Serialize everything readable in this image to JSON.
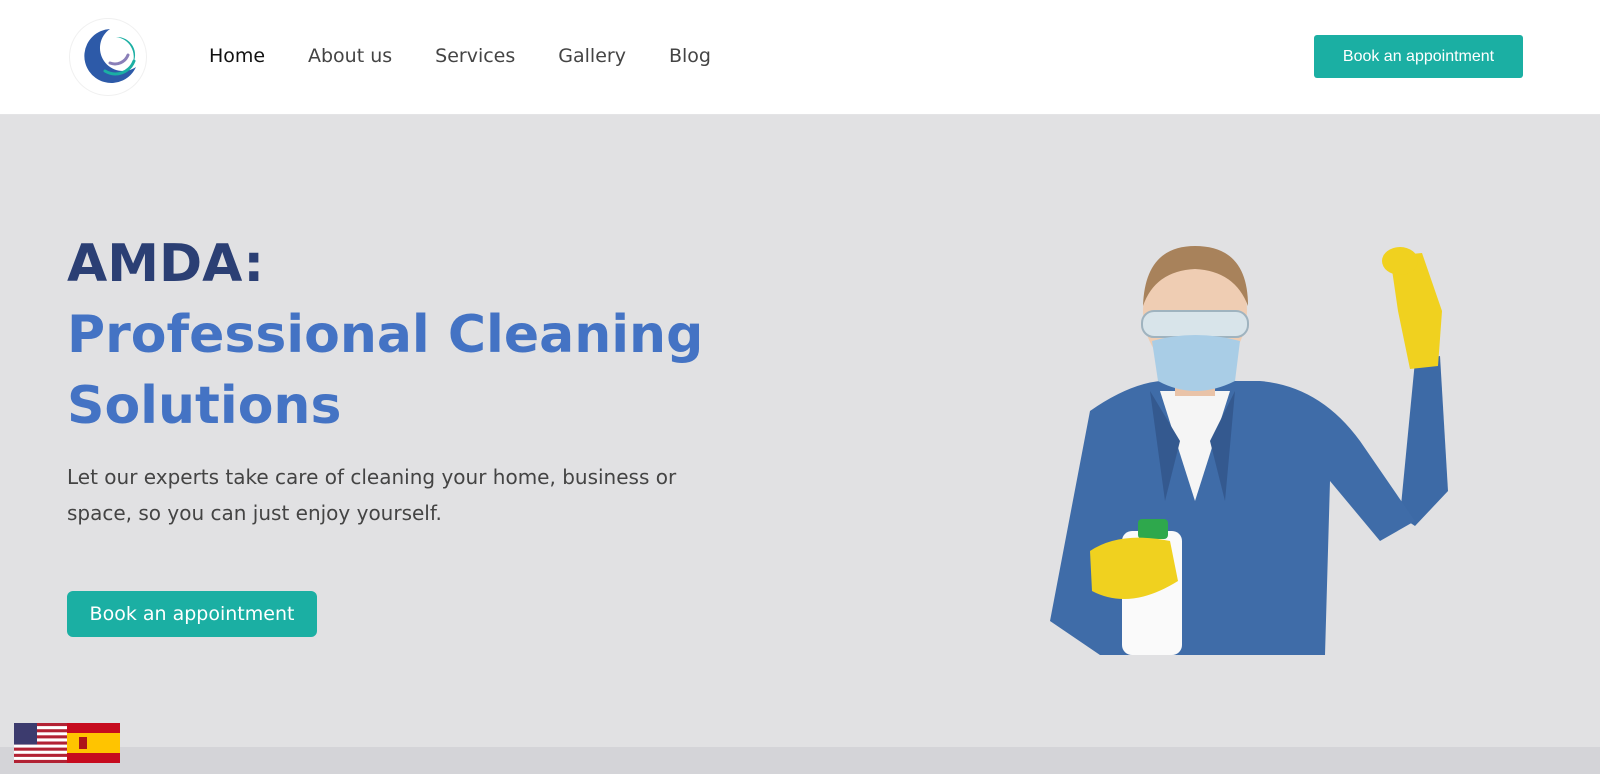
{
  "header": {
    "logo_icon": "crescent-swirl-logo-icon",
    "nav": [
      {
        "label": "Home",
        "active": true
      },
      {
        "label": "About us",
        "active": false
      },
      {
        "label": "Services",
        "active": false
      },
      {
        "label": "Gallery",
        "active": false
      },
      {
        "label": "Blog",
        "active": false
      }
    ],
    "cta_label": "Book an appointment"
  },
  "hero": {
    "brand": "AMDA:",
    "tagline": "Professional Cleaning Solutions",
    "description": "Let our experts take care of cleaning your home, business or space, so you can just enjoy yourself.",
    "cta_label": "Book an appointment",
    "image": "cleaner-woman-thumbs-up-image"
  },
  "language_switcher": {
    "flags": [
      "us-flag-icon",
      "spain-flag-icon"
    ]
  },
  "colors": {
    "accent": "#1bafa3",
    "brand_dark": "#2b3f74",
    "brand_blue": "#4473c4",
    "hero_bg": "#e1e1e3"
  }
}
